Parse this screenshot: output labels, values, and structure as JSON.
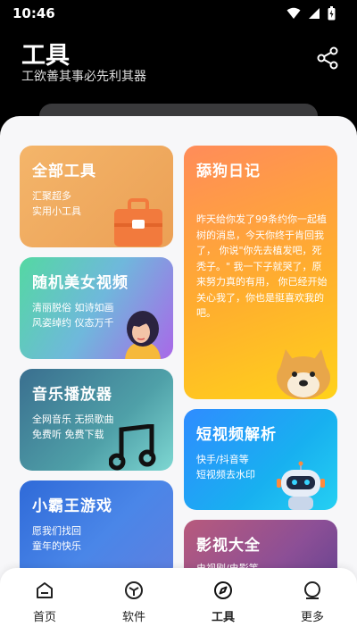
{
  "status": {
    "time": "10:46"
  },
  "header": {
    "title": "工具",
    "subtitle": "工欲善其事必先利其器"
  },
  "cards": {
    "all_tools": {
      "title": "全部工具",
      "desc_line1": "汇聚超多",
      "desc_line2": "实用小工具"
    },
    "random_girl": {
      "title": "随机美女视频",
      "desc_line1": "清丽脱俗 如诗如画",
      "desc_line2": "风姿绰约 仪态万千"
    },
    "music": {
      "title": "音乐播放器",
      "desc_line1": "全网音乐 无损歌曲",
      "desc_line2": "免费听 免费下载"
    },
    "game": {
      "title": "小霸王游戏",
      "desc_line1": "愿我们找回",
      "desc_line2": "童年的快乐"
    },
    "diary": {
      "title": "舔狗日记",
      "text": "昨天给你发了99条约你一起植树的消息，今天你终于肯回我了， 你说\"你先去植发吧，死秃子。\" 我一下子就哭了，原来努力真的有用， 你已经开始关心我了，你也是挺喜欢我的吧。"
    },
    "short_video": {
      "title": "短视频解析",
      "desc_line1": "快手/抖音等",
      "desc_line2": "短视频去水印"
    },
    "movie": {
      "title": "影视大全",
      "desc_line1": "电视剧/电影等"
    }
  },
  "tabs": [
    {
      "label": "首页",
      "icon": "home-icon",
      "active": false
    },
    {
      "label": "软件",
      "icon": "cube-icon",
      "active": false
    },
    {
      "label": "工具",
      "icon": "compass-icon",
      "active": true
    },
    {
      "label": "更多",
      "icon": "more-icon",
      "active": false
    }
  ],
  "colors": {
    "accent": "#000000",
    "background": "#f7f7f9"
  }
}
